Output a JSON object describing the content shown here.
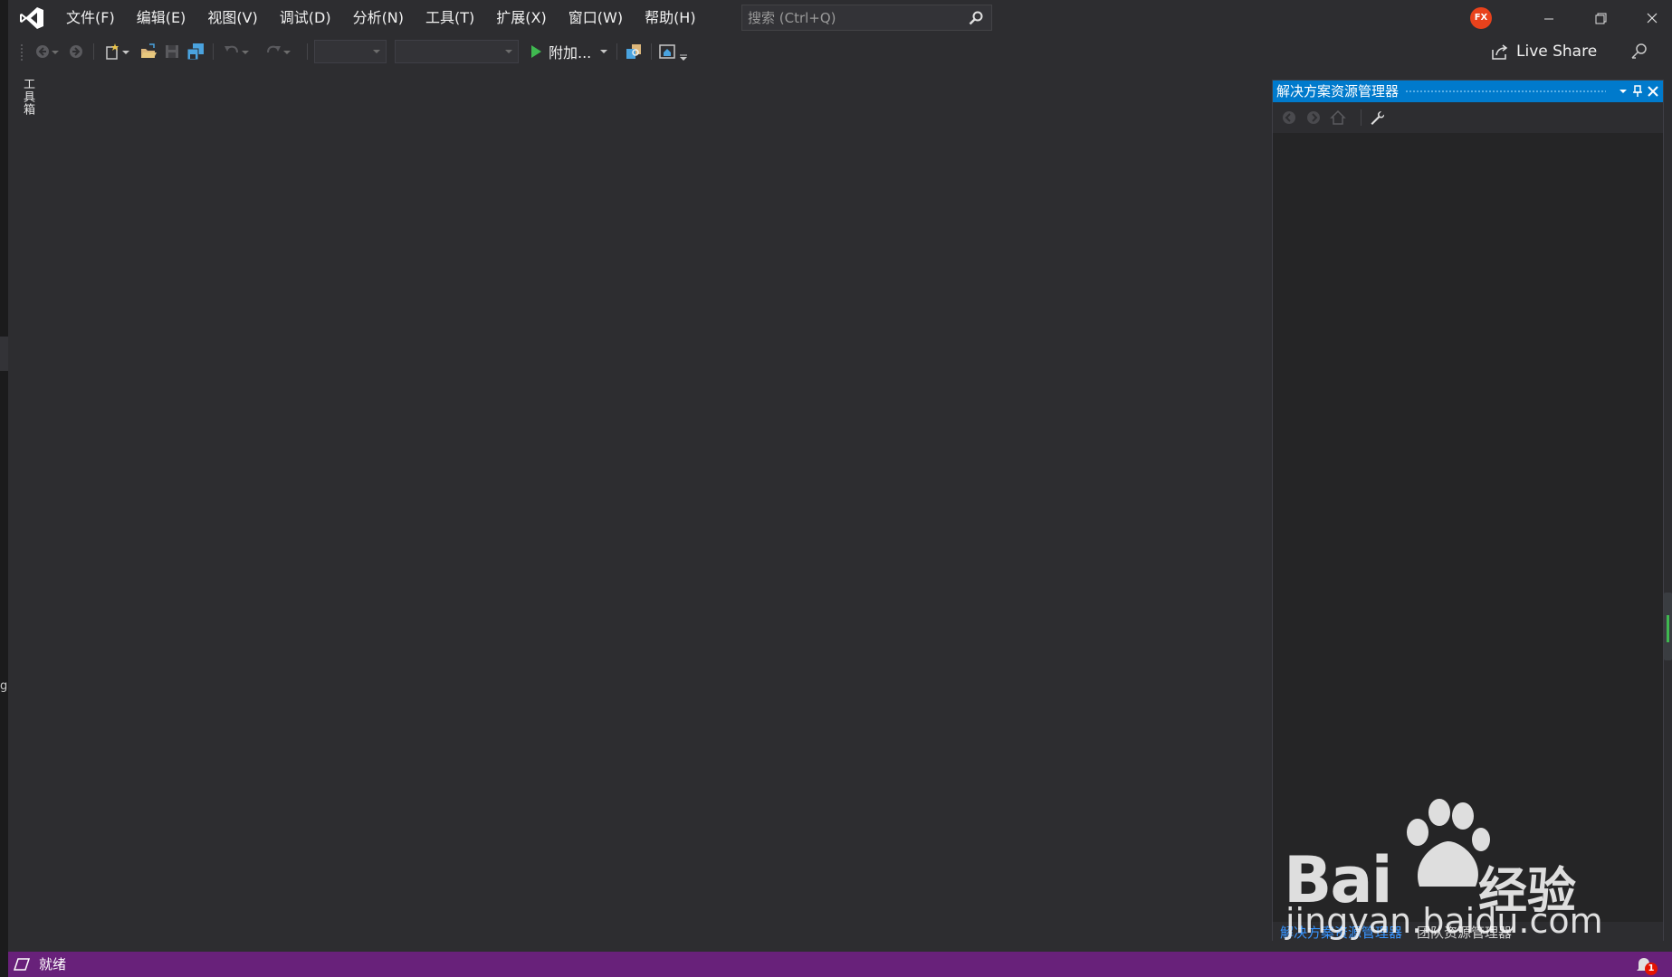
{
  "window": {
    "logo_icon": "visual-studio-logo-icon",
    "avatar_initials": "FX",
    "accent": "#007acc",
    "status_color": "#68217a"
  },
  "menu": {
    "items": [
      "文件(F)",
      "编辑(E)",
      "视图(V)",
      "调试(D)",
      "分析(N)",
      "工具(T)",
      "扩展(X)",
      "窗口(W)",
      "帮助(H)"
    ]
  },
  "search": {
    "placeholder": "搜索 (Ctrl+Q)",
    "icon": "search-icon"
  },
  "toolbar": {
    "attach_label": "附加...",
    "live_share_label": "Live Share"
  },
  "left_tab": {
    "label": "工具箱"
  },
  "solution_explorer": {
    "title": "解决方案资源管理器",
    "tabs": [
      {
        "label": "解决方案资源管理器",
        "active": true
      },
      {
        "label": "团队资源管理器",
        "active": false
      }
    ]
  },
  "status": {
    "text": "就绪",
    "notification_count": "1"
  },
  "left_edge": {
    "glyph": "g"
  },
  "watermark": {
    "brand": "Bai",
    "cn": "经验",
    "url": "jingyan.baidu.com"
  }
}
